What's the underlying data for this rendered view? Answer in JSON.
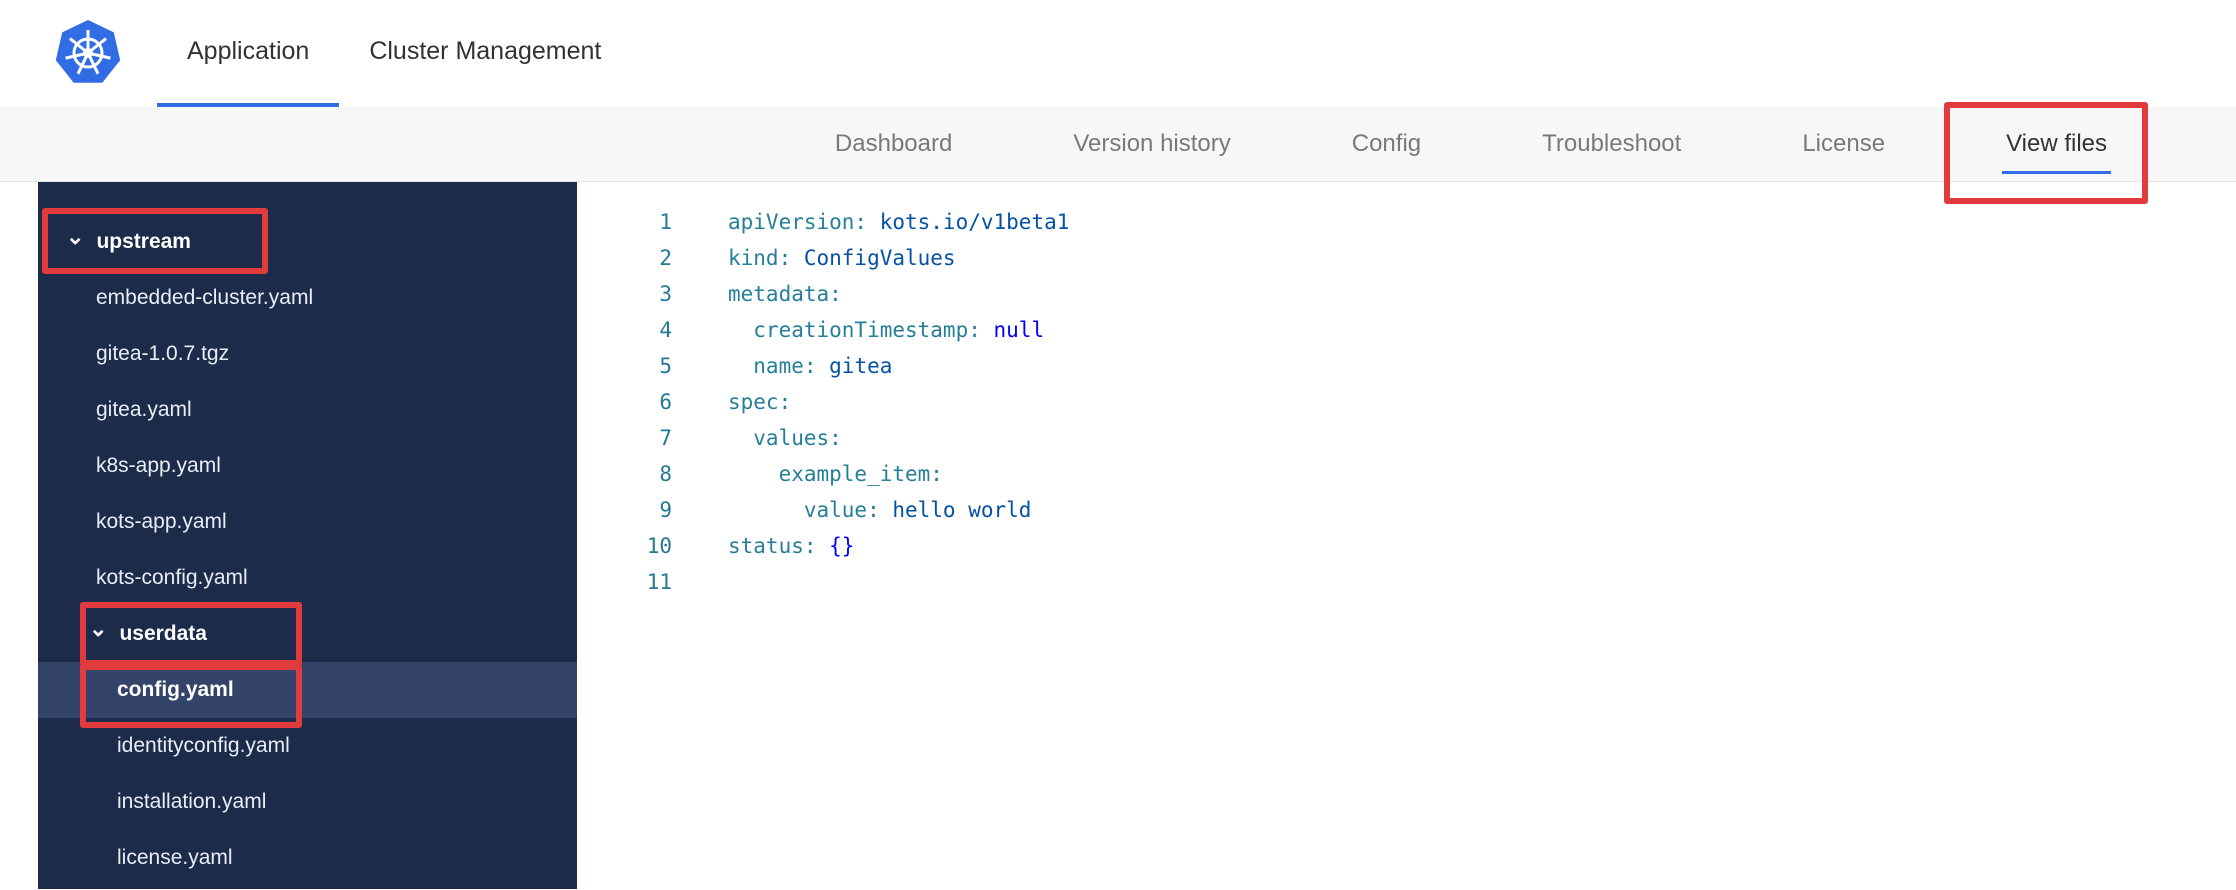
{
  "colors": {
    "accent_blue": "#326de6",
    "annotation_red": "#e13b3e",
    "sidebar_bg": "#1c2b4a",
    "sidebar_selected_bg": "#33436a",
    "yaml_key": "#267f99",
    "yaml_string": "#0451a5",
    "yaml_keyword": "#0000ff"
  },
  "icons": {
    "chevron_down": "⌄",
    "logo": "kubernetes-logo"
  },
  "header": {
    "tabs": [
      {
        "label": "Application",
        "active": true
      },
      {
        "label": "Cluster Management",
        "active": false
      }
    ]
  },
  "subnav": {
    "tabs": [
      {
        "label": "Dashboard",
        "active": false
      },
      {
        "label": "Version history",
        "active": false
      },
      {
        "label": "Config",
        "active": false
      },
      {
        "label": "Troubleshoot",
        "active": false
      },
      {
        "label": "License",
        "active": false
      },
      {
        "label": "View files",
        "active": true
      }
    ]
  },
  "tree": {
    "items": [
      {
        "label": "upstream",
        "type": "folder",
        "level": 0,
        "expanded": true
      },
      {
        "label": "embedded-cluster.yaml",
        "type": "file",
        "level": 1
      },
      {
        "label": "gitea-1.0.7.tgz",
        "type": "file",
        "level": 1
      },
      {
        "label": "gitea.yaml",
        "type": "file",
        "level": 1
      },
      {
        "label": "k8s-app.yaml",
        "type": "file",
        "level": 1
      },
      {
        "label": "kots-app.yaml",
        "type": "file",
        "level": 1
      },
      {
        "label": "kots-config.yaml",
        "type": "file",
        "level": 1
      },
      {
        "label": "userdata",
        "type": "folder",
        "level": 1,
        "expanded": true
      },
      {
        "label": "config.yaml",
        "type": "file",
        "level": 2,
        "selected": true
      },
      {
        "label": "identityconfig.yaml",
        "type": "file",
        "level": 2
      },
      {
        "label": "installation.yaml",
        "type": "file",
        "level": 2
      },
      {
        "label": "license.yaml",
        "type": "file",
        "level": 2
      }
    ]
  },
  "editor": {
    "lines": [
      {
        "num": "1",
        "key": "apiVersion:",
        "val": " kots.io/v1beta1"
      },
      {
        "num": "2",
        "key": "kind:",
        "val": " ConfigValues"
      },
      {
        "num": "3",
        "key": "metadata:",
        "val": ""
      },
      {
        "num": "4",
        "key": "  creationTimestamp:",
        "val": " null"
      },
      {
        "num": "5",
        "key": "  name:",
        "val": " gitea"
      },
      {
        "num": "6",
        "key": "spec:",
        "val": ""
      },
      {
        "num": "7",
        "key": "  values:",
        "val": ""
      },
      {
        "num": "8",
        "key": "    example_item:",
        "val": ""
      },
      {
        "num": "9",
        "key": "      value:",
        "val": " hello world"
      },
      {
        "num": "10",
        "key": "status:",
        "val": " {}"
      },
      {
        "num": "11",
        "key": "",
        "val": ""
      }
    ]
  },
  "annotations": {
    "color": "#e13b3e",
    "targets": [
      "View files tab",
      "upstream folder",
      "userdata folder",
      "config.yaml file"
    ]
  }
}
